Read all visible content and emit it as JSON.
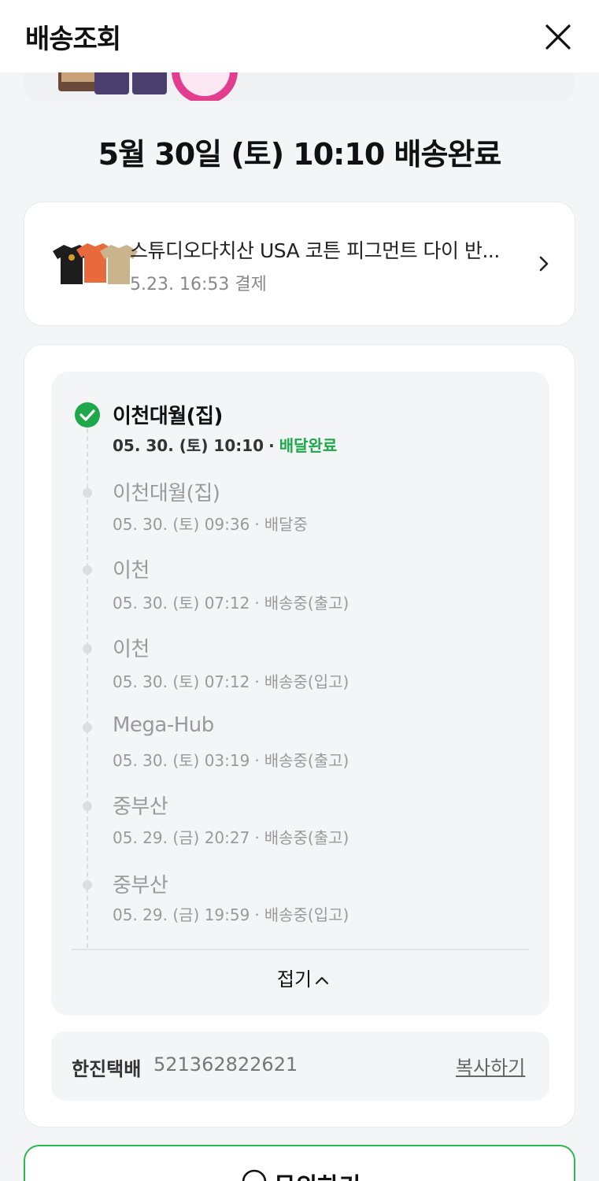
{
  "header": {
    "title": "배송조회",
    "close_icon": "close-icon"
  },
  "status_headline": "5월 30일 (토) 10:10 배송완료",
  "product": {
    "name": "스튜디오다치산 USA 코튼 피그먼트 다이 반...",
    "date": "5.23. 16:53 결제"
  },
  "timeline": [
    {
      "location": "이천대월(집)",
      "datetime": "05. 30. (토) 10:10",
      "status": "배달완료",
      "active": true
    },
    {
      "location": "이천대월(집)",
      "datetime": "05. 30. (토) 09:36",
      "status": "배달중"
    },
    {
      "location": "이천",
      "datetime": "05. 30. (토) 07:12",
      "status": "배송중(출고)"
    },
    {
      "location": "이천",
      "datetime": "05. 30. (토) 07:12",
      "status": "배송중(입고)"
    },
    {
      "location": "Mega-Hub",
      "datetime": "05. 30. (토) 03:19",
      "status": "배송중(출고)"
    },
    {
      "location": "중부산",
      "datetime": "05. 29. (금) 20:27",
      "status": "배송중(출고)"
    },
    {
      "location": "중부산",
      "datetime": "05. 29. (금) 19:59",
      "status": "배송중(입고)"
    }
  ],
  "fold_label": "접기",
  "courier": {
    "name": "한진택배",
    "tracking_number": "521362822621",
    "copy_label": "복사하기"
  },
  "inquiry_label": "문의하기",
  "colors": {
    "accent_green": "#1fa84a",
    "border_green": "#2db84f"
  }
}
